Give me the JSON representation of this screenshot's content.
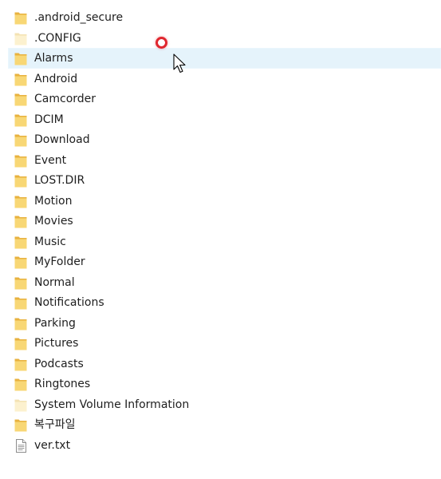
{
  "files": [
    {
      "name": ".android_secure",
      "type": "folder"
    },
    {
      "name": ".CONFIG",
      "type": "folder-hidden"
    },
    {
      "name": "Alarms",
      "type": "folder",
      "state": "hover"
    },
    {
      "name": "Android",
      "type": "folder"
    },
    {
      "name": "Camcorder",
      "type": "folder"
    },
    {
      "name": "DCIM",
      "type": "folder"
    },
    {
      "name": "Download",
      "type": "folder"
    },
    {
      "name": "Event",
      "type": "folder"
    },
    {
      "name": "LOST.DIR",
      "type": "folder"
    },
    {
      "name": "Motion",
      "type": "folder"
    },
    {
      "name": "Movies",
      "type": "folder"
    },
    {
      "name": "Music",
      "type": "folder"
    },
    {
      "name": "MyFolder",
      "type": "folder"
    },
    {
      "name": "Normal",
      "type": "folder"
    },
    {
      "name": "Notifications",
      "type": "folder"
    },
    {
      "name": "Parking",
      "type": "folder"
    },
    {
      "name": "Pictures",
      "type": "folder"
    },
    {
      "name": "Podcasts",
      "type": "folder"
    },
    {
      "name": "Ringtones",
      "type": "folder"
    },
    {
      "name": "System Volume Information",
      "type": "folder-hidden"
    },
    {
      "name": "복구파일",
      "type": "folder"
    },
    {
      "name": "ver.txt",
      "type": "text-file"
    }
  ],
  "icons": {
    "folder": "folder-icon",
    "folder-hidden": "hidden-folder-icon",
    "text-file": "text-file-icon",
    "cursor": "mouse-pointer-icon",
    "click": "click-indicator-icon"
  },
  "colors": {
    "folder": "#f8d775",
    "folder_back": "#e8b23f",
    "folder_hidden": "#fcf1cf",
    "hover_bg": "#e5f3fb",
    "click_marker": "#e0272f",
    "text": "#1e1e1e"
  }
}
